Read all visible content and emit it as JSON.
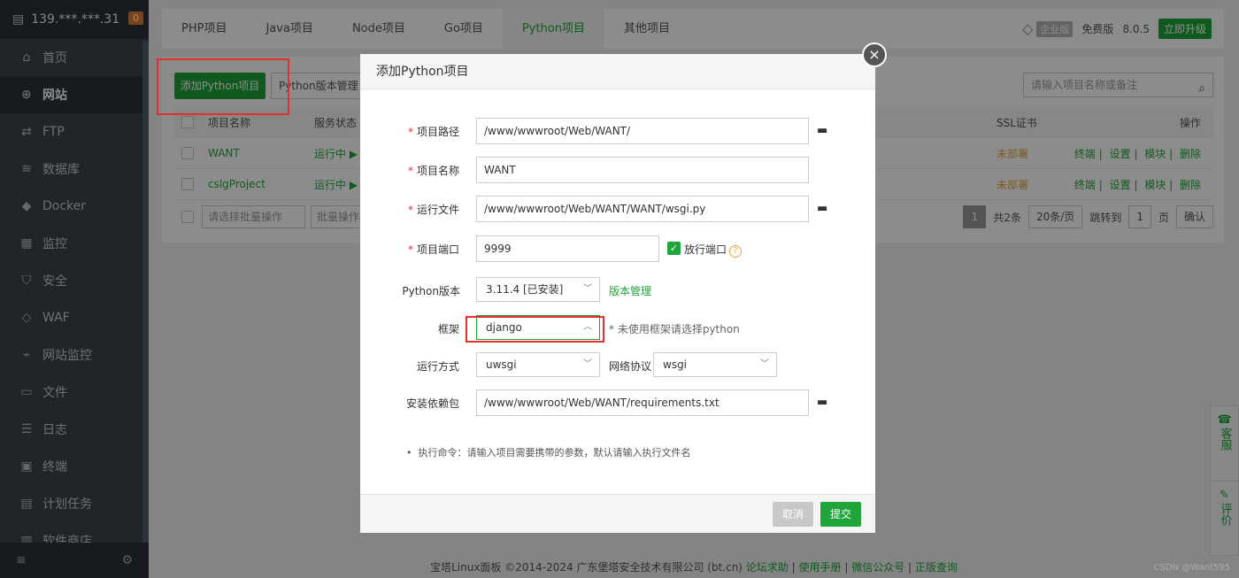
{
  "sidebar": {
    "server_ip": "139.***.***.31",
    "badge": "0",
    "items": [
      {
        "label": "首页",
        "icon": "home-icon",
        "glyph": "⌂"
      },
      {
        "label": "网站",
        "icon": "globe-icon",
        "glyph": "⊕"
      },
      {
        "label": "FTP",
        "icon": "ftp-icon",
        "glyph": "⇄"
      },
      {
        "label": "数据库",
        "icon": "database-icon",
        "glyph": "≋"
      },
      {
        "label": "Docker",
        "icon": "docker-icon",
        "glyph": "◆"
      },
      {
        "label": "监控",
        "icon": "monitor-icon",
        "glyph": "▦"
      },
      {
        "label": "安全",
        "icon": "shield-icon",
        "glyph": "⛉"
      },
      {
        "label": "WAF",
        "icon": "waf-icon",
        "glyph": "◇"
      },
      {
        "label": "网站监控",
        "icon": "chart-icon",
        "glyph": "⌁"
      },
      {
        "label": "文件",
        "icon": "folder-icon",
        "glyph": "▭"
      },
      {
        "label": "日志",
        "icon": "log-icon",
        "glyph": "☰"
      },
      {
        "label": "终端",
        "icon": "terminal-icon",
        "glyph": "▣"
      },
      {
        "label": "计划任务",
        "icon": "schedule-icon",
        "glyph": "▤"
      },
      {
        "label": "软件商店",
        "icon": "store-icon",
        "glyph": "▥"
      }
    ]
  },
  "tabs": [
    "PHP项目",
    "Java项目",
    "Node项目",
    "Go项目",
    "Python项目",
    "其他项目"
  ],
  "topbar": {
    "edition": "企业版",
    "free": "免费版",
    "version": "8.0.5",
    "upgrade": "立即升级"
  },
  "toolbar": {
    "add_python": "添加Python项目",
    "version_mgmt": "Python版本管理",
    "search_placeholder": "请输入项目名称或备注"
  },
  "table": {
    "headers": {
      "name": "项目名称",
      "status": "服务状态",
      "ssl": "SSL证书",
      "ops": "操作"
    },
    "rows": [
      {
        "name": "WANT",
        "status": "运行中 ▶",
        "ssl": "未部署",
        "ops": [
          "终端",
          "设置",
          "模块",
          "删除"
        ]
      },
      {
        "name": "cslgProject",
        "status": "运行中 ▶",
        "ssl": "未部署",
        "ops": [
          "终端",
          "设置",
          "模块",
          "删除"
        ]
      }
    ]
  },
  "pager": {
    "batch_placeholder": "请选择批量操作",
    "batch_btn": "批量操作",
    "current": "1",
    "total": "共2条",
    "per_page": "20条/页",
    "jump": "跳转到",
    "jump_value": "1",
    "page_unit": "页",
    "confirm": "确认"
  },
  "modal": {
    "title": "添加Python项目",
    "close": "×",
    "fields": {
      "path_label": "项目路径",
      "path_value": "/www/wwwroot/Web/WANT/",
      "name_label": "项目名称",
      "name_value": "WANT",
      "runfile_label": "运行文件",
      "runfile_value": "/www/wwwroot/Web/WANT/WANT/wsgi.py",
      "port_label": "项目端口",
      "port_value": "9999",
      "open_port_label": "放行端口",
      "pyver_label": "Python版本",
      "pyver_value": "3.11.4 [已安装]",
      "pyver_link": "版本管理",
      "framework_label": "框架",
      "framework_value": "django",
      "framework_hint": "* 未使用框架请选择python",
      "runmode_label": "运行方式",
      "runmode_value": "uwsgi",
      "protocol_label": "网络协议",
      "protocol_value": "wsgi",
      "deps_label": "安装依赖包",
      "deps_value": "/www/wwwroot/Web/WANT/requirements.txt"
    },
    "note": "执行命令：请输入项目需要携带的参数，默认请输入执行文件名",
    "cancel": "取消",
    "submit": "提交"
  },
  "footer": {
    "copyright": "宝塔Linux面板 ©2014-2024 广东堡塔安全技术有限公司 (bt.cn)",
    "links": [
      "论坛求助",
      "使用手册",
      "微信公众号",
      "正版查询"
    ],
    "watermark": "CSDN @Want595"
  },
  "float": {
    "service": "客服",
    "review": "评价"
  }
}
